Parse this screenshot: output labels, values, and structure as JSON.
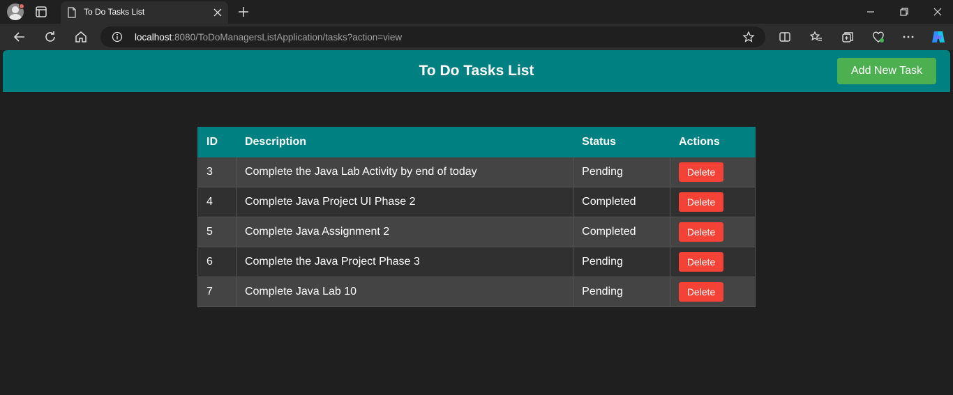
{
  "browser": {
    "tab_title": "To Do Tasks List",
    "url_host": "localhost",
    "url_path": ":8080/ToDoManagersListApplication/tasks?action=view"
  },
  "app": {
    "title": "To Do Tasks List",
    "add_button": "Add New Task",
    "colors": {
      "header": "#008080",
      "add": "#4caf50",
      "delete": "#f44336"
    }
  },
  "table": {
    "headers": [
      "ID",
      "Description",
      "Status",
      "Actions"
    ],
    "rows": [
      {
        "id": "3",
        "description": "Complete the Java Lab Activity by end of today",
        "status": "Pending",
        "action": "Delete"
      },
      {
        "id": "4",
        "description": "Complete Java Project UI Phase 2",
        "status": "Completed",
        "action": "Delete"
      },
      {
        "id": "5",
        "description": "Complete Java Assignment 2",
        "status": "Completed",
        "action": "Delete"
      },
      {
        "id": "6",
        "description": "Complete the Java Project Phase 3",
        "status": "Pending",
        "action": "Delete"
      },
      {
        "id": "7",
        "description": "Complete Java Lab 10",
        "status": "Pending",
        "action": "Delete"
      }
    ]
  }
}
